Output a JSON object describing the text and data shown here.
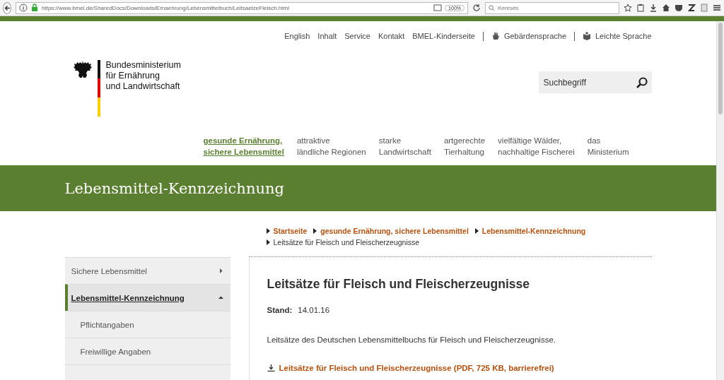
{
  "browser": {
    "url": "https://www.bmel.de/SharedDocs/Downloads/Ernaehrung/Lebensmittelbuch/LeitsaetzeFleisch.html",
    "zoom": "100%",
    "search_placeholder": "Keresés"
  },
  "service_links": [
    {
      "label": "English",
      "kind": "plain"
    },
    {
      "label": "Inhalt",
      "kind": "plain"
    },
    {
      "label": "Service",
      "kind": "plain"
    },
    {
      "label": "Kontakt",
      "kind": "plain"
    },
    {
      "label": "BMEL-Kinderseite",
      "kind": "plain"
    },
    {
      "label": "Gebärdensprache",
      "kind": "signing"
    },
    {
      "label": "Leichte Sprache",
      "kind": "simple"
    }
  ],
  "logo": {
    "lines": [
      "Bundesministerium",
      "für Ernährung",
      "und Landwirtschaft"
    ]
  },
  "search": {
    "placeholder": "Suchbegriff"
  },
  "main_nav": [
    {
      "lines": [
        "gesunde Ernährung,",
        "sichere Lebensmittel"
      ],
      "selected": true
    },
    {
      "lines": [
        "attraktive",
        "ländliche Regionen"
      ],
      "selected": false
    },
    {
      "lines": [
        "starke",
        "Landwirtschaft"
      ],
      "selected": false
    },
    {
      "lines": [
        "artgerechte",
        "Tierhaltung"
      ],
      "selected": false
    },
    {
      "lines": [
        "vielfältige Wälder,",
        "nachhaltige Fischerei"
      ],
      "selected": false
    },
    {
      "lines": [
        "das",
        "Ministerium"
      ],
      "selected": false
    }
  ],
  "section_title": "Lebensmittel-Kennzeichnung",
  "breadcrumb": [
    {
      "label": "Startseite",
      "link": true
    },
    {
      "label": "gesunde Ernährung, sichere Lebensmittel",
      "link": true
    },
    {
      "label": "Lebensmittel-Kennzeichnung",
      "link": true
    },
    {
      "label": "Leitsätze für Fleisch und Fleischerzeugnisse",
      "link": false
    }
  ],
  "sidebar": [
    {
      "label": "Sichere Lebensmittel",
      "kind": "section",
      "selected": false,
      "expanded": false
    },
    {
      "label": "Lebensmittel-Kennzeichnung",
      "kind": "section",
      "selected": true,
      "expanded": true
    },
    {
      "label": "Pflichtangaben",
      "kind": "sub",
      "selected": false,
      "expanded": false
    },
    {
      "label": "Freiwillige Angaben",
      "kind": "sub",
      "selected": false,
      "expanded": false
    },
    {
      "kind": "cut",
      "selected": false,
      "expanded": false
    }
  ],
  "article": {
    "title": "Leitsätze für Fleisch und Fleischerzeugnisse",
    "date_label": "Stand:",
    "date": "14.01.16",
    "intro": "Leitsätze des Deutschen Lebensmittelbuchs für Fleisch und Fleischerzeugnisse.",
    "download": "Leitsätze für Fleisch und Fleischerzeugnisse (PDF, 725 KB, barrierefrei)"
  }
}
